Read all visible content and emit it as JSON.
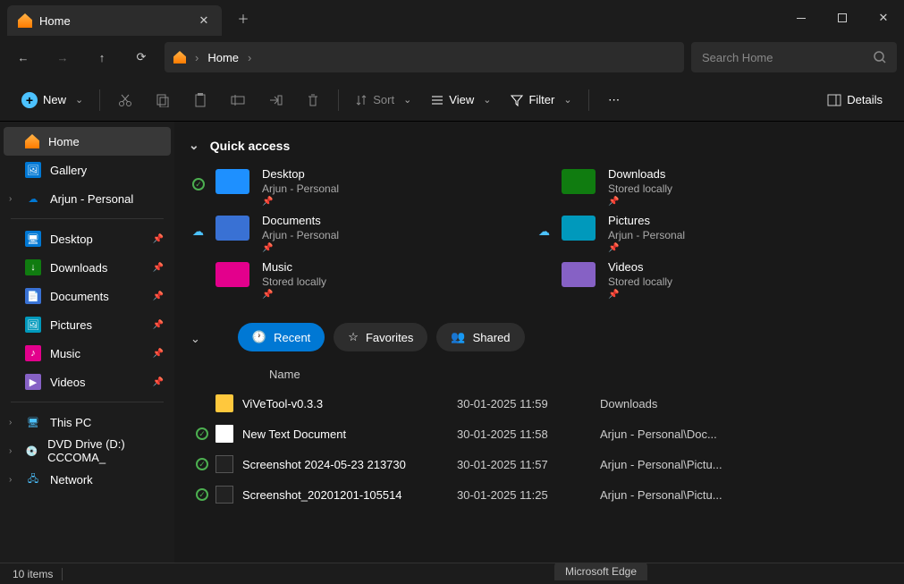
{
  "tab_title": "Home",
  "address": "Home",
  "search_placeholder": "Search Home",
  "toolbar": {
    "new": "New",
    "sort": "Sort",
    "view": "View",
    "filter": "Filter",
    "details": "Details"
  },
  "sidebar": {
    "top": [
      {
        "label": "Home",
        "icon": "home",
        "active": true
      },
      {
        "label": "Gallery",
        "icon": "gallery"
      },
      {
        "label": "Arjun - Personal",
        "icon": "onedrive",
        "chev": true
      }
    ],
    "pinned": [
      {
        "label": "Desktop",
        "icon": "desktop",
        "color": "#0078d4"
      },
      {
        "label": "Downloads",
        "icon": "downloads",
        "color": "#107c10"
      },
      {
        "label": "Documents",
        "icon": "documents",
        "color": "#3971d4"
      },
      {
        "label": "Pictures",
        "icon": "pictures",
        "color": "#0099bc"
      },
      {
        "label": "Music",
        "icon": "music",
        "color": "#e3008c"
      },
      {
        "label": "Videos",
        "icon": "videos",
        "color": "#8661c5"
      }
    ],
    "bottom": [
      {
        "label": "This PC",
        "icon": "pc",
        "chev": true
      },
      {
        "label": "DVD Drive (D:) CCCOMA_",
        "icon": "dvd",
        "chev": true
      },
      {
        "label": "Network",
        "icon": "network",
        "chev": true
      }
    ]
  },
  "quick_access": {
    "title": "Quick access",
    "items": [
      {
        "name": "Desktop",
        "sub": "Arjun - Personal",
        "status": "ok",
        "color": "#1e90ff"
      },
      {
        "name": "Downloads",
        "sub": "Stored locally",
        "color": "#107c10"
      },
      {
        "name": "Documents",
        "sub": "Arjun - Personal",
        "status": "cloud",
        "color": "#3971d4"
      },
      {
        "name": "Pictures",
        "sub": "Arjun - Personal",
        "status": "cloud",
        "color": "#0099bc"
      },
      {
        "name": "Music",
        "sub": "Stored locally",
        "color": "#e3008c"
      },
      {
        "name": "Videos",
        "sub": "Stored locally",
        "color": "#8661c5"
      }
    ]
  },
  "pills": {
    "recent": "Recent",
    "favorites": "Favorites",
    "shared": "Shared"
  },
  "list": {
    "header": "Name",
    "rows": [
      {
        "name": "ViVeTool-v0.3.3",
        "date": "30-01-2025 11:59",
        "loc": "Downloads",
        "ico": "folder",
        "status": ""
      },
      {
        "name": "New Text Document",
        "date": "30-01-2025 11:58",
        "loc": "Arjun - Personal\\Doc...",
        "ico": "txt",
        "status": "ok"
      },
      {
        "name": "Screenshot 2024-05-23 213730",
        "date": "30-01-2025 11:57",
        "loc": "Arjun - Personal\\Pictu...",
        "ico": "img",
        "status": "ok"
      },
      {
        "name": "Screenshot_20201201-105514",
        "date": "30-01-2025 11:25",
        "loc": "Arjun - Personal\\Pictu...",
        "ico": "img",
        "status": "ok"
      }
    ]
  },
  "status": "10 items",
  "edge": "Microsoft Edge"
}
